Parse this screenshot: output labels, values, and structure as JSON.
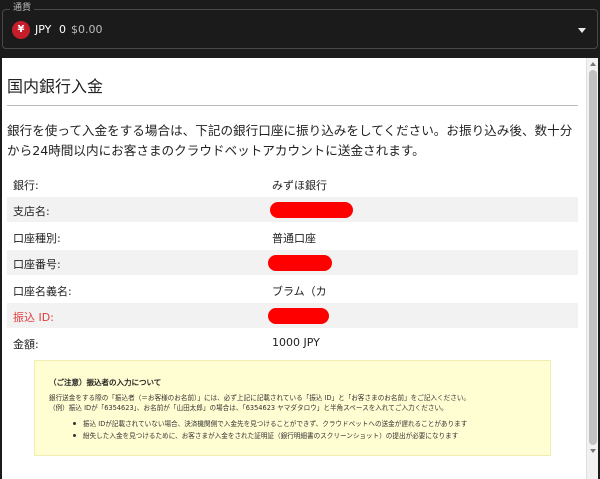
{
  "currency": {
    "legend": "通貨",
    "icon": "yen-icon",
    "symbol": "¥",
    "code": "JPY",
    "amount": "0",
    "usd": "$0.00"
  },
  "deposit": {
    "title": "国内銀行入金",
    "intro": "銀行を使って入金をする場合は、下記の銀行口座に振り込みをしてください。お振り込み後、数十分から24時間以内にお客さまのクラウドベットアカウントに送金されます。",
    "rows": [
      {
        "label": "銀行:",
        "value": "みずほ銀行"
      },
      {
        "label": "支店名:",
        "value": ""
      },
      {
        "label": "口座種別:",
        "value": "普通口座"
      },
      {
        "label": "口座番号:",
        "value": ""
      },
      {
        "label": "口座名義名:",
        "value": "ブラム（カ"
      },
      {
        "label": "振込 ID:",
        "value": ""
      },
      {
        "label": "金額:",
        "value": "1000 JPY"
      }
    ]
  },
  "note": {
    "title": "（ご注意）振込者の入力について",
    "line1": "銀行送金をする際の「振込者（＝お客様のお名前）」には、必ず上記に記載されている「振込 ID」と「お客さまのお名前」をご記入ください。",
    "line2": "（例）振込 IDが「6354623」、お名前が「山田太郎」の場合は、「6354623 ヤマダタロウ」と半角スペースを入れてご入力ください。",
    "bullets": [
      "振込 IDが記載されていない場合、決済機関側で入金先を見つけることができず、クラウドベットへの送金が遅れることがあります",
      "紛失した入金を見つけるために、お客さまが入金をされた証明証（銀行明細書のスクリーンショット）の提出が必要になります"
    ]
  },
  "colors": {
    "background": "#1b1b1b",
    "yen_badge": "#c41e2a",
    "redaction": "#ff0000",
    "highlight_label": "#e23b3b",
    "note_bg": "#fffdd2"
  }
}
